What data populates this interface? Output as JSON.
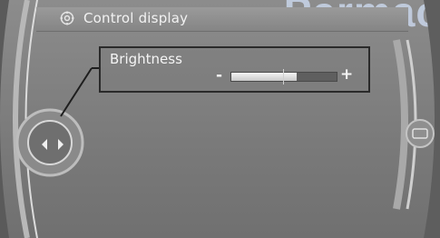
{
  "header": {
    "title": "Control display",
    "icon": "gear-settings-icon"
  },
  "setting": {
    "label": "Brightness",
    "minus_symbol": "-",
    "plus_symbol": "+",
    "level_fraction": 0.62
  },
  "watermark": {
    "text": "Parmac"
  },
  "colors": {
    "panel": "#7a7a7a",
    "text": "#f4f4f4",
    "highlight_border": "#2a2a2a"
  }
}
